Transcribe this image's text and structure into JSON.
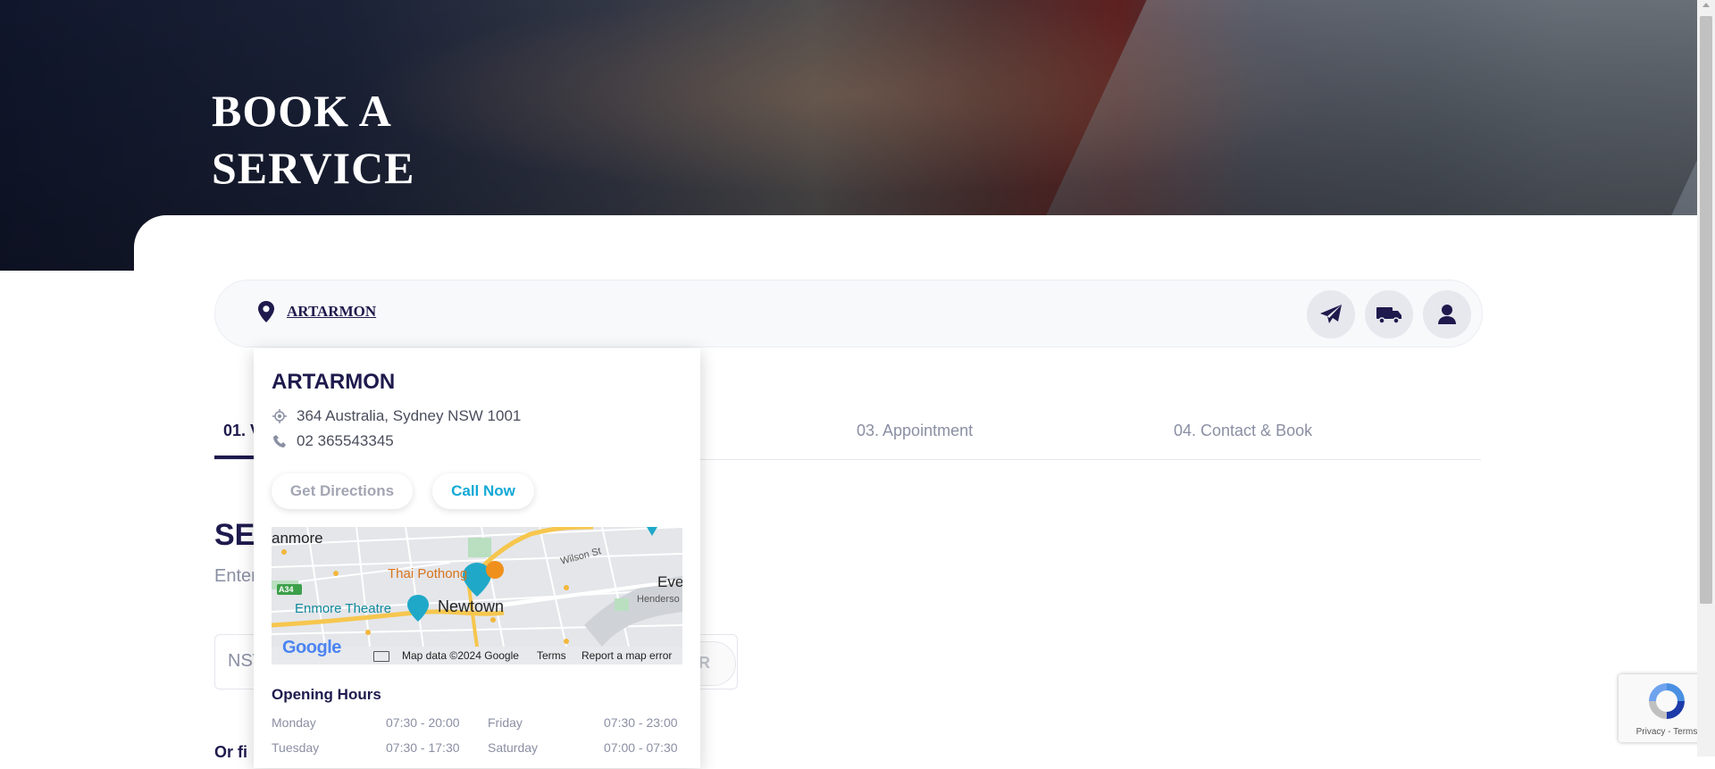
{
  "hero": {
    "title": "BOOK A SERVICE"
  },
  "location_bar": {
    "location_name": "ARTARMON",
    "icons": [
      "location-pin-icon",
      "paper-plane-icon",
      "truck-icon",
      "user-icon"
    ]
  },
  "tabs": [
    {
      "label": "01. V"
    },
    {
      "label": "03. Appointment"
    },
    {
      "label": "04. Contact & Book"
    }
  ],
  "section": {
    "heading_partial": "SE",
    "subtitle_partial": "Enter",
    "search_placeholder_partial": "NSV",
    "search_button_partial": "R",
    "or_find_partial": "Or fi"
  },
  "popup": {
    "title": "ARTARMON",
    "address": "364 Australia, Sydney NSW 1001",
    "phone": "02 365543345",
    "get_directions": "Get Directions",
    "call_now": "Call Now",
    "map": {
      "labels": {
        "anmore": "anmore",
        "thai": "Thai Pothong",
        "wilson": "Wilson St",
        "eve": "Eve",
        "hender": "Henderso",
        "a34": "A34",
        "enmore": "Enmore Theatre",
        "newtown": "Newtown"
      },
      "logo": "Google",
      "map_data": "Map data ©2024 Google",
      "terms": "Terms",
      "report": "Report a map error"
    },
    "opening_hours_title": "Opening Hours",
    "hours": [
      {
        "day": "Monday",
        "time": "07:30 - 20:00"
      },
      {
        "day": "Friday",
        "time": "07:30 - 23:00"
      },
      {
        "day": "Tuesday",
        "time": "07:30 - 17:30"
      },
      {
        "day": "Saturday",
        "time": "07:00 - 07:30"
      }
    ]
  },
  "recaptcha": {
    "text": "Privacy - Terms"
  },
  "colors": {
    "primary": "#1e1a4d",
    "accent": "#12a9d6",
    "muted": "#8a8fa3"
  }
}
